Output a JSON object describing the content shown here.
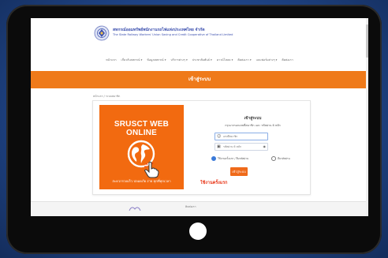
{
  "org": {
    "name_th": "สหกรณ์ออมทรัพย์พนักงานรถไฟแห่งประเทศไทย จำกัด",
    "name_en": "The State Railway Workers' Union Saving and Credit Cooperative of Thailand Limited"
  },
  "nav": {
    "items": [
      {
        "label": "หน้าแรก",
        "dropdown": false
      },
      {
        "label": "เกี่ยวกับสหกรณ์",
        "dropdown": true
      },
      {
        "label": "ข้อมูลสหกรณ์",
        "dropdown": true
      },
      {
        "label": "บริการต่างๆ",
        "dropdown": true
      },
      {
        "label": "ประชาสัมพันธ์",
        "dropdown": true
      },
      {
        "label": "ดาวน์โหลด",
        "dropdown": true
      },
      {
        "label": "ติดต่อเรา",
        "dropdown": true
      },
      {
        "label": "แบบฟอร์มต่างๆ",
        "dropdown": true
      },
      {
        "label": "ติดต่อเรา",
        "dropdown": false
      }
    ]
  },
  "banner": {
    "title": "เข้าสู่ระบบ"
  },
  "breadcrumb": "หน้าแรก / ระบบสมาชิก",
  "promo": {
    "title": "SRUSCT WEB ONLINE",
    "subtitle": "สะดวกรวดเร็ว  ปลอดภัย  ง่าย  ทุกที่ทุกเวลา"
  },
  "login": {
    "title": "เข้าสู่ระบบ",
    "hint": "กรุณากรอกเลขที่สมาชิก และ รหัสผ่าน 6 หลัก",
    "username_placeholder": "เลขที่สมาชิก",
    "password_placeholder": "รหัสผ่าน 6 หลัก",
    "option_member": "ใช้งานครั้งแรก / ลืมรหัสผ่าน",
    "option_forgot": "ลืมรหัสผ่าน",
    "button": "เข้าสู่ระบบ"
  },
  "first_use_label": "ใช้งานครั้งแรก",
  "footer": {
    "text": "ติดต่อเรา"
  },
  "colors": {
    "accent": "#ef7a1a",
    "promo": "#f26a10",
    "brand_text": "#3b4fae",
    "callout": "#e8381a"
  },
  "icons": [
    "user-icon",
    "lock-icon",
    "eye-icon",
    "globe-icon",
    "pointing-hand-icon",
    "org-seal-icon"
  ]
}
